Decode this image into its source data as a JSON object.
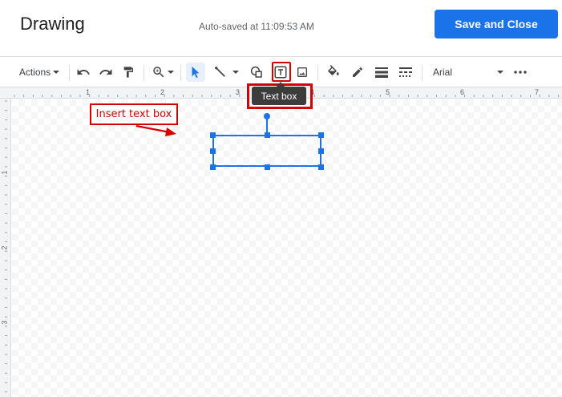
{
  "header": {
    "title": "Drawing",
    "autosave_text": "Auto-saved at 11:09:53 AM",
    "save_button": "Save and Close"
  },
  "toolbar": {
    "actions_label": "Actions",
    "font_name": "Arial",
    "icons": [
      "undo-icon",
      "redo-icon",
      "paint-format-icon",
      "zoom-icon",
      "select-icon",
      "line-icon",
      "shape-icon",
      "text-box-icon",
      "image-icon",
      "fill-color-icon",
      "border-color-icon",
      "border-weight-icon",
      "border-dash-icon",
      "more-icon"
    ]
  },
  "tooltip": {
    "text": "Text box"
  },
  "annotation": {
    "label": "Insert text box",
    "color": "#d40000"
  },
  "rulers": {
    "horizontal_numbers": [
      "1",
      "2",
      "3",
      "4",
      "5",
      "6",
      "7"
    ],
    "vertical_numbers": [
      "1",
      "2",
      "3"
    ]
  },
  "colors": {
    "accent": "#1a73e8",
    "annotation": "#d40000"
  }
}
